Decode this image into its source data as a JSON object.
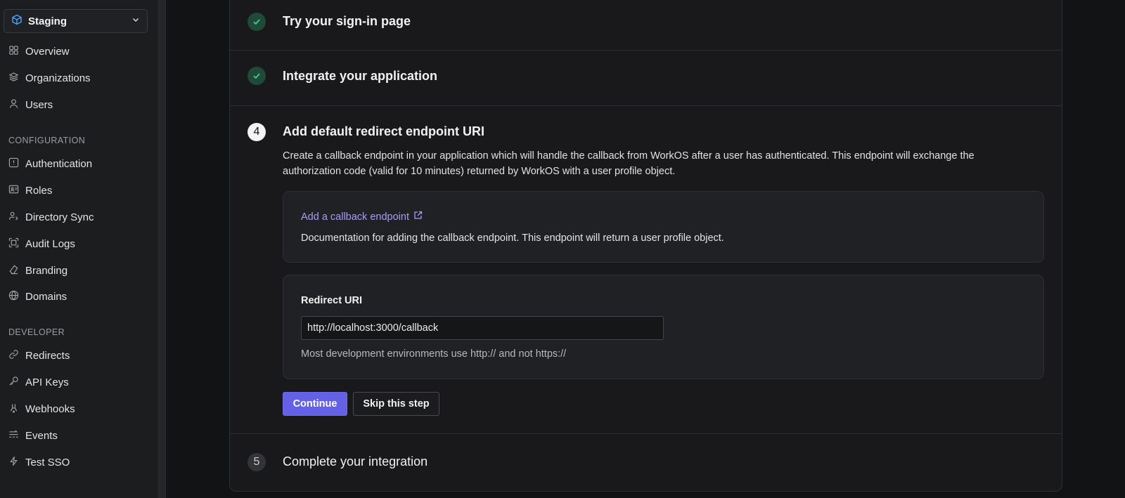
{
  "sidebar": {
    "environment": {
      "label": "Staging",
      "icon": "cube-icon"
    },
    "top_items": [
      {
        "label": "Overview",
        "icon": "grid-icon"
      },
      {
        "label": "Organizations",
        "icon": "layers-icon"
      },
      {
        "label": "Users",
        "icon": "user-icon"
      }
    ],
    "configuration_title": "CONFIGURATION",
    "configuration_items": [
      {
        "label": "Authentication",
        "icon": "key-box-icon"
      },
      {
        "label": "Roles",
        "icon": "id-card-icon"
      },
      {
        "label": "Directory Sync",
        "icon": "users-sync-icon"
      },
      {
        "label": "Audit Logs",
        "icon": "scan-icon"
      },
      {
        "label": "Branding",
        "icon": "paint-icon"
      },
      {
        "label": "Domains",
        "icon": "globe-icon"
      }
    ],
    "developer_title": "DEVELOPER",
    "developer_items": [
      {
        "label": "Redirects",
        "icon": "link-icon"
      },
      {
        "label": "API Keys",
        "icon": "wrench-key-icon"
      },
      {
        "label": "Webhooks",
        "icon": "webhook-icon"
      },
      {
        "label": "Events",
        "icon": "events-icon"
      },
      {
        "label": "Test SSO",
        "icon": "bolt-icon"
      }
    ]
  },
  "steps": {
    "step_try": {
      "title": "Try your sign-in page",
      "status": "done"
    },
    "step_integrate": {
      "title": "Integrate your application",
      "status": "done"
    },
    "step_redirect": {
      "number": "4",
      "title": "Add default redirect endpoint URI",
      "description": "Create a callback endpoint in your application which will handle the callback from WorkOS after a user has authenticated. This endpoint will exchange the authorization code (valid for 10 minutes) returned by WorkOS with a user profile object.",
      "doc_card": {
        "link_label": "Add a callback endpoint",
        "text": "Documentation for adding the callback endpoint. This endpoint will return a user profile object."
      },
      "redirect_card": {
        "label": "Redirect URI",
        "value": "http://localhost:3000/callback",
        "hint": "Most development environments use http:// and not https://"
      },
      "continue_label": "Continue",
      "skip_label": "Skip this step"
    },
    "step_complete": {
      "number": "5",
      "title": "Complete your integration"
    }
  },
  "colors": {
    "accent": "#6461e6",
    "link": "#a99cf6",
    "success": "#3ecf8e",
    "env_icon": "#4aa3ff"
  }
}
